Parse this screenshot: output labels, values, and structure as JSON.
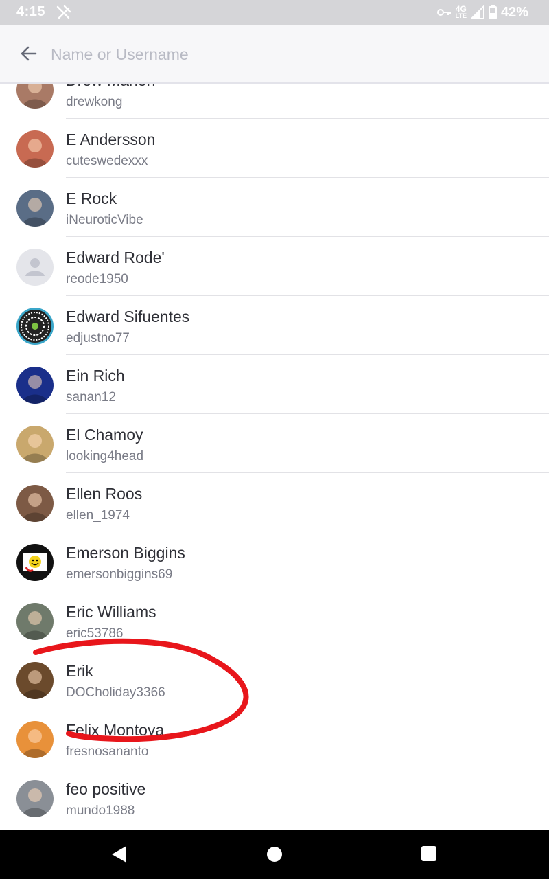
{
  "status_bar": {
    "time": "4:15",
    "network": "4G",
    "network_sub": "LTE",
    "battery": "42%",
    "icons": [
      "notification-off-icon",
      "key-icon",
      "signal-icon",
      "battery-icon"
    ]
  },
  "search": {
    "placeholder": "Name or Username",
    "value": ""
  },
  "contacts": [
    {
      "name": "Drew Mahon",
      "username": "drewkong",
      "avatar_color": "#a97a66",
      "avatar": "photo"
    },
    {
      "name": "E Andersson",
      "username": "cuteswedexxx",
      "avatar_color": "#c86a52",
      "avatar": "photo"
    },
    {
      "name": "E Rock",
      "username": "iNeuroticVibe",
      "avatar_color": "#5a6d86",
      "avatar": "photo"
    },
    {
      "name": "Edward Rode'",
      "username": "reode1950",
      "avatar_color": "#e4e5ea",
      "avatar": "default-person-icon"
    },
    {
      "name": "Edward Sifuentes",
      "username": "edjustno77",
      "avatar_color": "#222222",
      "avatar": "qr-code-icon"
    },
    {
      "name": "Ein Rich",
      "username": "sanan12",
      "avatar_color": "#1a2f8a",
      "avatar": "photo"
    },
    {
      "name": "El Chamoy",
      "username": "looking4head",
      "avatar_color": "#c9a86d",
      "avatar": "photo"
    },
    {
      "name": "Ellen Roos",
      "username": "ellen_1974",
      "avatar_color": "#7d5a45",
      "avatar": "photo"
    },
    {
      "name": "Emerson Biggins",
      "username": "emersonbiggins69",
      "avatar_color": "#111111",
      "avatar": "smiley-icon"
    },
    {
      "name": "Eric Williams",
      "username": "eric53786",
      "avatar_color": "#6f7a6b",
      "avatar": "photo"
    },
    {
      "name": "Erik",
      "username": "DOCholiday3366",
      "avatar_color": "#6b4a2c",
      "avatar": "photo"
    },
    {
      "name": "Felix Montoya",
      "username": "fresnosananto",
      "avatar_color": "#e8913a",
      "avatar": "photo"
    },
    {
      "name": "feo positive",
      "username": "mundo1988",
      "avatar_color": "#8a8f96",
      "avatar": "photo"
    }
  ],
  "annotation": {
    "color": "#e8161b",
    "highlighted_contact": "Erik"
  },
  "nav_bar": {
    "icons": [
      "nav-back-icon",
      "nav-home-icon",
      "nav-recent-apps-icon"
    ]
  }
}
